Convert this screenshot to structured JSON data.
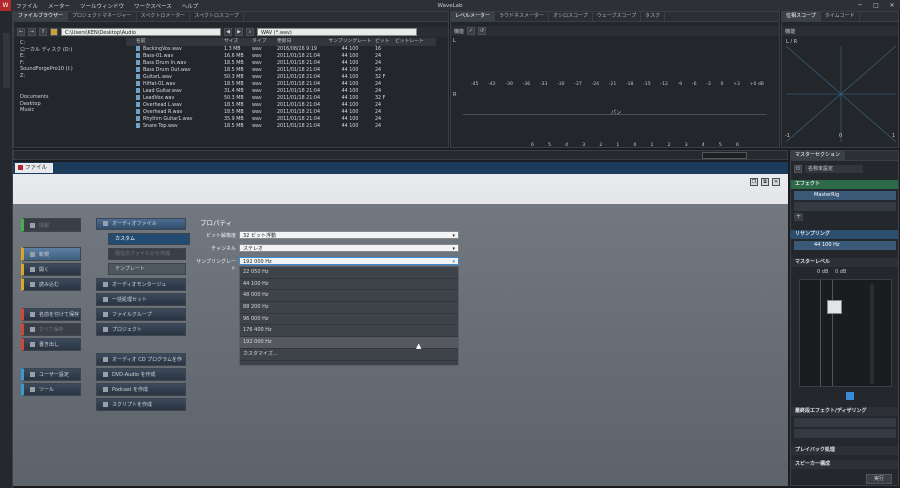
{
  "app": {
    "title": "WaveLab",
    "menu": [
      "ファイル",
      "メーター",
      "ツールウィンドウ",
      "ワークスペース",
      "ヘルプ"
    ]
  },
  "browser": {
    "tabs": [
      "ファイルブラウザー",
      "プロジェクトマネージャー",
      "スペクトロメーター",
      "スペクトロスコープ"
    ],
    "path": "C:\\Users\\KEN\\Desktop\\Audio",
    "filter": "WAV (*.wav)",
    "tree": [
      "C:",
      "ローカル ディスク (D:)",
      "E:",
      "F:",
      "SoundForgePro10 (I:)",
      "Z:"
    ],
    "places": [
      "Documents",
      "Desktop",
      "Music"
    ],
    "columns": [
      "名前",
      "サイズ",
      "タイプ",
      "更新日",
      "サンプリングレート",
      "ビット",
      "ビットレート"
    ],
    "files": [
      [
        "BackingVox.wav",
        "1.3 MB",
        "wav",
        "2016/08/26 9:19",
        "44 100",
        "16",
        ""
      ],
      [
        "Bass-01.wav",
        "16.6 MB",
        "wav",
        "2011/01/18 21:04",
        "44 100",
        "24",
        ""
      ],
      [
        "Bass Drum In.wav",
        "18.5 MB",
        "wav",
        "2011/01/18 21:04",
        "44 100",
        "24",
        ""
      ],
      [
        "Bass Drum Out.wav",
        "18.5 MB",
        "wav",
        "2011/01/18 21:04",
        "44 100",
        "24",
        ""
      ],
      [
        "GuitarL.wav",
        "50.3 MB",
        "wav",
        "2011/01/18 21:04",
        "44 100",
        "32 F",
        ""
      ],
      [
        "HiHat-01.wav",
        "18.5 MB",
        "wav",
        "2011/01/18 21:04",
        "44 100",
        "24",
        ""
      ],
      [
        "Lead Guitar.wav",
        "31.4 MB",
        "wav",
        "2011/01/18 21:04",
        "44 100",
        "24",
        ""
      ],
      [
        "LeadVox.wav",
        "50.3 MB",
        "wav",
        "2011/01/18 21:04",
        "44 100",
        "32 F",
        ""
      ],
      [
        "Overhead L.wav",
        "18.5 MB",
        "wav",
        "2011/01/18 21:04",
        "44 100",
        "24",
        ""
      ],
      [
        "Overhead R.wav",
        "18.5 MB",
        "wav",
        "2011/01/18 21:04",
        "44 100",
        "24",
        ""
      ],
      [
        "Rhythm Guitar1.wav",
        "35.9 MB",
        "wav",
        "2011/01/18 21:04",
        "44 100",
        "24",
        ""
      ],
      [
        "Snare Top.wav",
        "18.5 MB",
        "wav",
        "2011/01/18 21:04",
        "44 100",
        "24",
        ""
      ]
    ]
  },
  "meter": {
    "tabs": [
      "レベルメーター",
      "ラウドネスメーター",
      "オシロスコープ",
      "ウェーブスコープ",
      "タスク"
    ],
    "func": "機能",
    "scale": [
      "-45",
      "-42",
      "-39",
      "-36",
      "-33",
      "-30",
      "-27",
      "-24",
      "-21",
      "-18",
      "-15",
      "-12",
      "-9",
      "-6",
      "-3",
      "0",
      "+3",
      "+6 dB"
    ],
    "L": "L",
    "R": "R",
    "pan": "パン",
    "bottom_scale": [
      "6",
      "5",
      "4",
      "3",
      "2",
      "1",
      "0",
      "1",
      "2",
      "3",
      "4",
      "5",
      "6"
    ]
  },
  "scope": {
    "tabs": [
      "位相スコープ",
      "タイムコード"
    ],
    "func": "機能",
    "lr": "L / R",
    "m1": "-1",
    "z": "0",
    "p1": "1"
  },
  "file_tab": {
    "label": "ファイル"
  },
  "left_nav": {
    "info": "情報",
    "new": "新規",
    "open": "開く",
    "import": "読み込む",
    "save_as": "名前を付けて保存",
    "save_all": "すべて保存",
    "export": "書き出し",
    "prefs": "ユーザー設定",
    "tools": "ツール"
  },
  "mid_nav": {
    "audio_file": "オーディオファイル",
    "custom": "カスタム",
    "from_template": "現在のファイルから作成",
    "template": "テンプレート",
    "montage": "オーディオモンタージュ",
    "batch": "一括処理セット",
    "filegroup": "ファイルグループ",
    "project": "プロジェクト",
    "cd": "オーディオ CD プログラムを作成",
    "dvd": "DVD-Audio を作成",
    "podcast": "Podcast を作成",
    "script": "スクリプトを作成"
  },
  "props": {
    "title": "プロパティ",
    "bit_label": "ビット解像度",
    "bit_value": "32 ビット浮動",
    "ch_label": "チャンネル",
    "ch_value": "ステレオ",
    "sr_label": "サンプリングレート",
    "sr_value": "192 000 Hz",
    "sr_options": [
      "22 050 Hz",
      "44 100 Hz",
      "48 000 Hz",
      "88 200 Hz",
      "96 000 Hz",
      "176 400 Hz",
      "192 000 Hz"
    ],
    "customize": "カスタマイズ..."
  },
  "master": {
    "title": "マスターセクション",
    "preset": "名称未設定",
    "effects": "エフェクト",
    "plugin": "MasterRig",
    "resampling": "リサンプリング",
    "rs_value": "44 100 Hz",
    "level": "マスターレベル",
    "db1": "0 dB",
    "db2": "0 dB",
    "final": "最終段エフェクト/ディザリング",
    "playback": "プレイバック処理",
    "speaker": "スピーカー構成",
    "render": "実行"
  }
}
